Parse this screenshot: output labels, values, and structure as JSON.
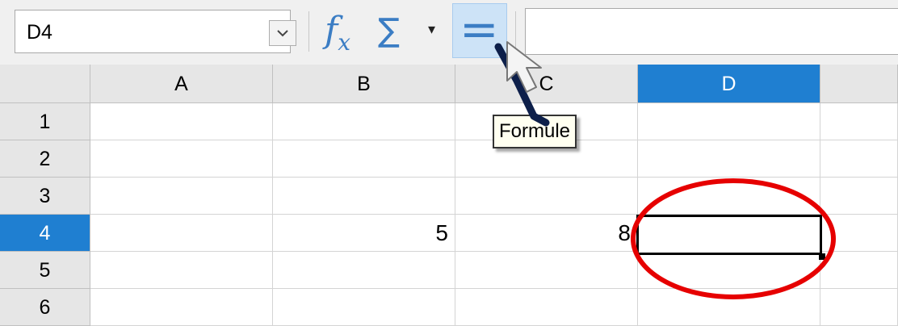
{
  "name_box": {
    "value": "D4"
  },
  "toolbar": {
    "function_wizard_icon": "fx-icon",
    "sum_icon": "sigma-icon",
    "sum_dropdown_glyph": "▾",
    "formula_icon": "equals-icon",
    "formula_input_value": ""
  },
  "tooltip": {
    "text": "Formule"
  },
  "columns": [
    {
      "label": "A",
      "active": false
    },
    {
      "label": "B",
      "active": false
    },
    {
      "label": "C",
      "active": false
    },
    {
      "label": "D",
      "active": true
    }
  ],
  "rows": [
    {
      "label": "1",
      "cells": [
        "",
        "",
        "",
        ""
      ]
    },
    {
      "label": "2",
      "cells": [
        "",
        "",
        "",
        ""
      ]
    },
    {
      "label": "3",
      "cells": [
        "",
        "",
        "",
        ""
      ]
    },
    {
      "label": "4",
      "cells": [
        "",
        "5",
        "8",
        ""
      ]
    },
    {
      "label": "5",
      "cells": [
        "",
        "",
        "",
        ""
      ]
    },
    {
      "label": "6",
      "cells": [
        "",
        "",
        "",
        ""
      ]
    }
  ],
  "selected_cell": "D4",
  "colors": {
    "accent": "#1f7fd1",
    "icon_blue": "#3b7dc4",
    "annotation_red": "#e60000",
    "pen_stroke": "#0d1f4a"
  }
}
